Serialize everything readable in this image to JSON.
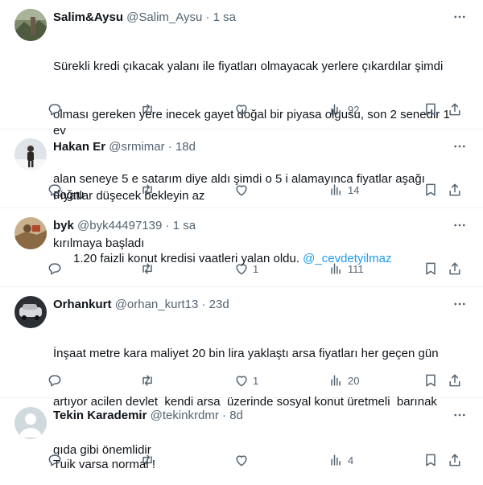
{
  "tweets": [
    {
      "name": "Salim&Aysu",
      "handle": "@Salim_Aysu",
      "sep": " · ",
      "time": "1 sa",
      "text_lines": [
        "Sürekli kredi çıkacak yalanı ile fiyatları olmayacak yerlere çıkardılar şimdi",
        "olması gereken yere inecek gayet doğal bir piyasa olgusu, son 2 senedir 1 ev",
        "alan seneye 5 e satarım diye aldı şimdi o 5 i alamayınca fiyatlar aşağı doğru",
        "kırılmaya başladı"
      ],
      "likes": "",
      "views": "92",
      "avatar": "landscape"
    },
    {
      "name": "Hakan Er",
      "handle": "@srmimar",
      "sep": " · ",
      "time": "18d",
      "text_lines": [
        "Fiyatlar düşecek bekleyin az"
      ],
      "likes": "",
      "views": "14",
      "avatar": "person-snow"
    },
    {
      "name": "byk",
      "handle": "@byk44497139",
      "sep": " · ",
      "time": "1 sa",
      "text_prefix": "1.20 faizli konut kredisi vaatleri yalan oldu. ",
      "mention": "@_cevdetyilmaz",
      "likes": "1",
      "views": "111",
      "avatar": "brown"
    },
    {
      "name": "Orhankurt",
      "handle": "@orhan_kurt13",
      "sep": " · ",
      "time": "23d",
      "text_lines": [
        "İnşaat metre kara maliyet 20 bin lira yaklaştı arsa fiyatları her geçen gün",
        "artıyor acilen devlet  kendi arsa  üzerinde sosyal konut üretmeli  barınak",
        "gıda gibi önemlidir"
      ],
      "likes": "1",
      "views": "20",
      "avatar": "car"
    },
    {
      "name": "Tekin Karademir",
      "handle": "@tekinkrdmr",
      "sep": " · ",
      "time": "8d",
      "text_lines": [
        "Tuik varsa normal !"
      ],
      "likes": "",
      "views": "4",
      "avatar": "default"
    }
  ],
  "icons": {
    "reply": "reply-icon",
    "retweet": "retweet-icon",
    "like": "heart-icon",
    "views": "views-icon",
    "bookmark": "bookmark-icon",
    "share": "share-icon",
    "more": "more-icon"
  },
  "colors": {
    "text": "#0f1419",
    "secondary": "#536471",
    "link": "#1d9bf0",
    "divider": "#eff3f4"
  }
}
